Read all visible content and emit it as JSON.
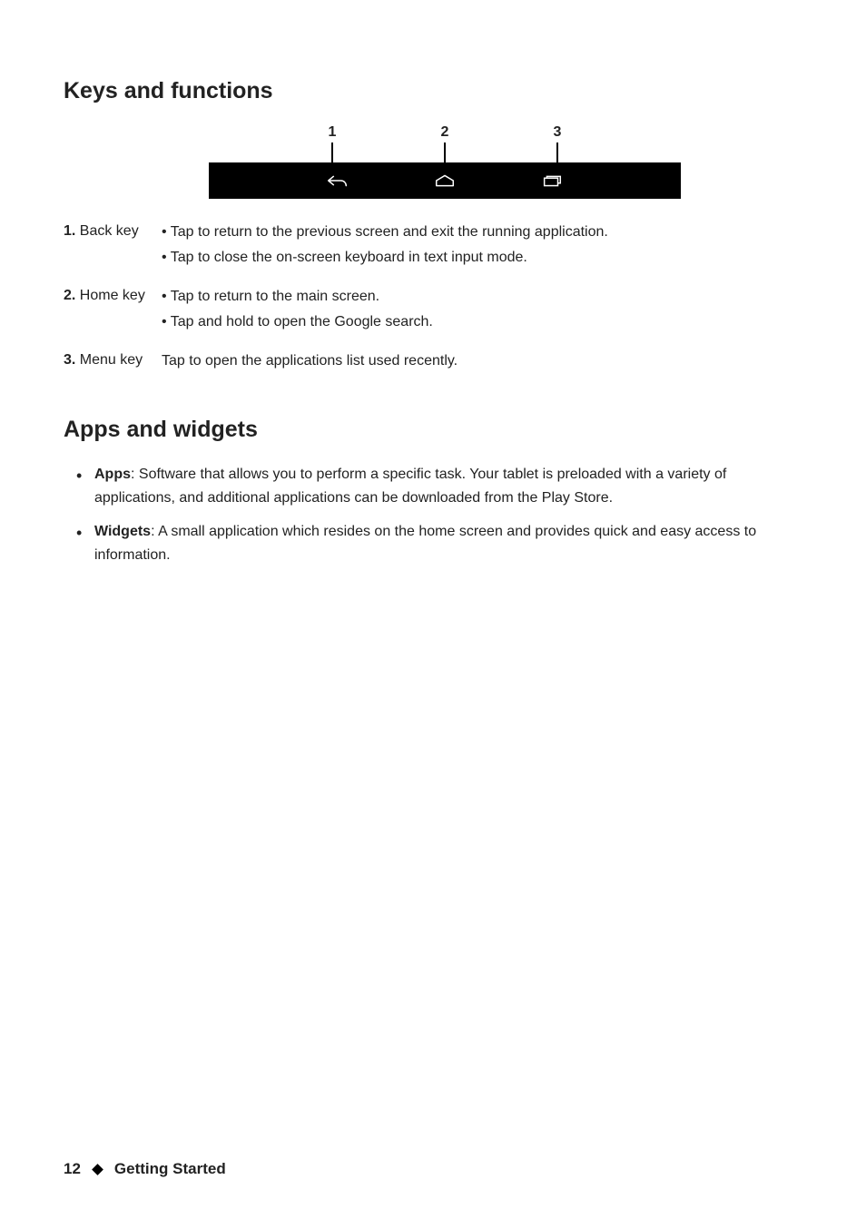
{
  "section1": {
    "heading": "Keys and functions",
    "callouts": [
      "1",
      "2",
      "3"
    ],
    "rows": [
      {
        "num": "1.",
        "label": " Back key",
        "items": [
          "• Tap to return to the previous screen and exit the running application.",
          "• Tap to close the on-screen keyboard in text input mode."
        ]
      },
      {
        "num": "2.",
        "label": " Home key",
        "items": [
          "• Tap to return to the main screen.",
          "• Tap and hold to open the Google search."
        ]
      },
      {
        "num": "3.",
        "label": " Menu key",
        "items": [
          "Tap to open the applications list used recently."
        ]
      }
    ]
  },
  "section2": {
    "heading": "Apps and widgets",
    "items": [
      {
        "bold": "Apps",
        "text": ": Software that allows you to perform a specific task. Your tablet is preloaded with a variety of applications, and additional applications can be downloaded from the Play Store."
      },
      {
        "bold": "Widgets",
        "text": ": A small application which resides on the home screen and provides quick and easy access to information."
      }
    ]
  },
  "footer": {
    "page": "12",
    "section": "Getting Started"
  }
}
